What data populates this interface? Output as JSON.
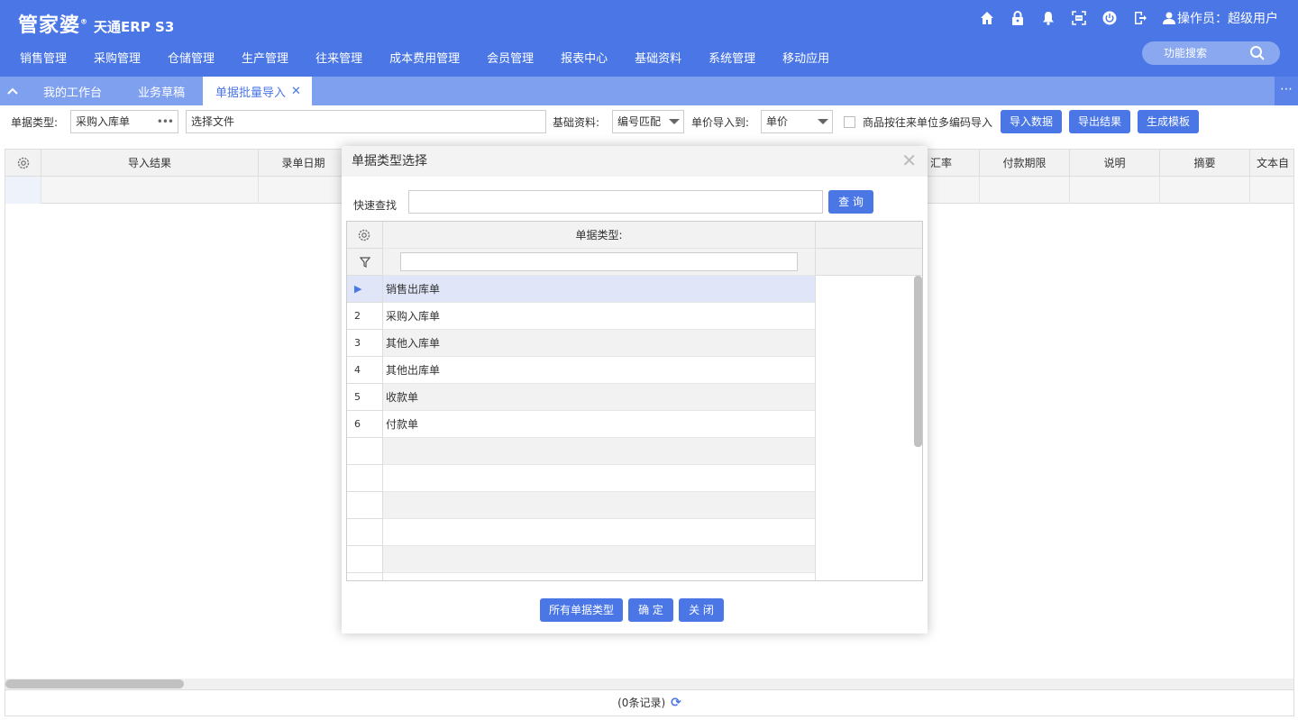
{
  "header": {
    "logo_main": "管家婆",
    "logo_mark": "®",
    "logo_sub": "天通ERP S3",
    "operator": "操作员：超级用户",
    "icons": [
      "home-icon",
      "lock-icon",
      "bell-icon",
      "scan-icon",
      "power-icon",
      "logout-icon",
      "user-icon"
    ]
  },
  "menu": [
    "销售管理",
    "采购管理",
    "仓储管理",
    "生产管理",
    "往来管理",
    "成本费用管理",
    "会员管理",
    "报表中心",
    "基础资料",
    "系统管理",
    "移动应用"
  ],
  "search": {
    "label": "功能搜索"
  },
  "tabs": [
    {
      "label": "我的工作台"
    },
    {
      "label": "业务草稿"
    },
    {
      "label": "单据批量导入",
      "active": true
    }
  ],
  "toolbar": {
    "doc_type_label": "单据类型:",
    "doc_type_value": "采购入库单",
    "file_value": "选择文件",
    "base_label": "基础资料:",
    "base_value": "编号匹配",
    "price_label": "单价导入到:",
    "price_value": "单价",
    "checkbox_label": "商品按往来单位多编码导入",
    "btn_import": "导入数据",
    "btn_export": "导出结果",
    "btn_template": "生成模板"
  },
  "grid": {
    "columns": [
      "导入结果",
      "录单日期",
      "汇率",
      "付款期限",
      "说明",
      "摘要",
      "文本自"
    ],
    "footer": "(0条记录)"
  },
  "dialog": {
    "title": "单据类型选择",
    "search_label": "快速查找",
    "search_button": "查 询",
    "column_header": "单据类型:",
    "rows": [
      {
        "no": "",
        "name": "销售出库单"
      },
      {
        "no": "2",
        "name": "采购入库单"
      },
      {
        "no": "3",
        "name": "其他入库单"
      },
      {
        "no": "4",
        "name": "其他出库单"
      },
      {
        "no": "5",
        "name": "收款单"
      },
      {
        "no": "6",
        "name": "付款单"
      }
    ],
    "btn_all": "所有单据类型",
    "btn_ok": "确 定",
    "btn_close": "关 闭"
  },
  "colors": {
    "primary": "#4a76e6",
    "tabbar": "#7ea0ef",
    "selected_row": "#e0e6f8"
  }
}
